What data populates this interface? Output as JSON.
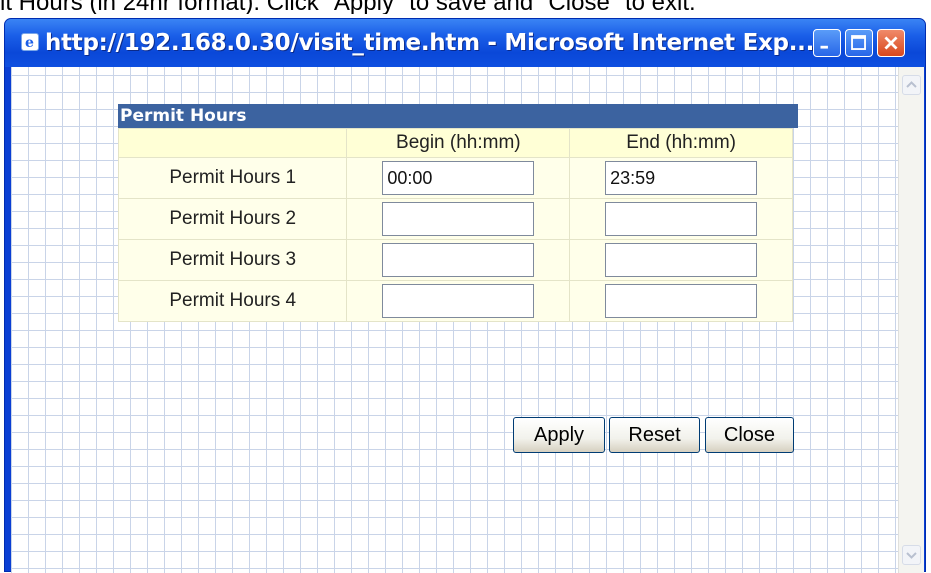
{
  "caption": "it Hours (in 24hr format). Click \"Apply\" to save and \"Close\" to exit.",
  "window": {
    "title": "http://192.168.0.30/visit_time.htm - Microsoft Internet Exp...",
    "icon": "ie-page-icon",
    "controls": [
      "minimize-icon",
      "maximize-icon",
      "close-icon"
    ],
    "accent_color": "#0a3fd4"
  },
  "panel": {
    "header": "Permit Hours",
    "columns": {
      "begin": "Begin (hh:mm)",
      "end": "End (hh:mm)"
    },
    "rows": [
      {
        "label": "Permit Hours 1",
        "begin": "00:00",
        "end": "23:59"
      },
      {
        "label": "Permit Hours 2",
        "begin": "",
        "end": ""
      },
      {
        "label": "Permit Hours 3",
        "begin": "",
        "end": ""
      },
      {
        "label": "Permit Hours 4",
        "begin": "",
        "end": ""
      }
    ],
    "header_color": "#3c63a0"
  },
  "buttons": {
    "apply": "Apply",
    "reset": "Reset",
    "close": "Close"
  }
}
